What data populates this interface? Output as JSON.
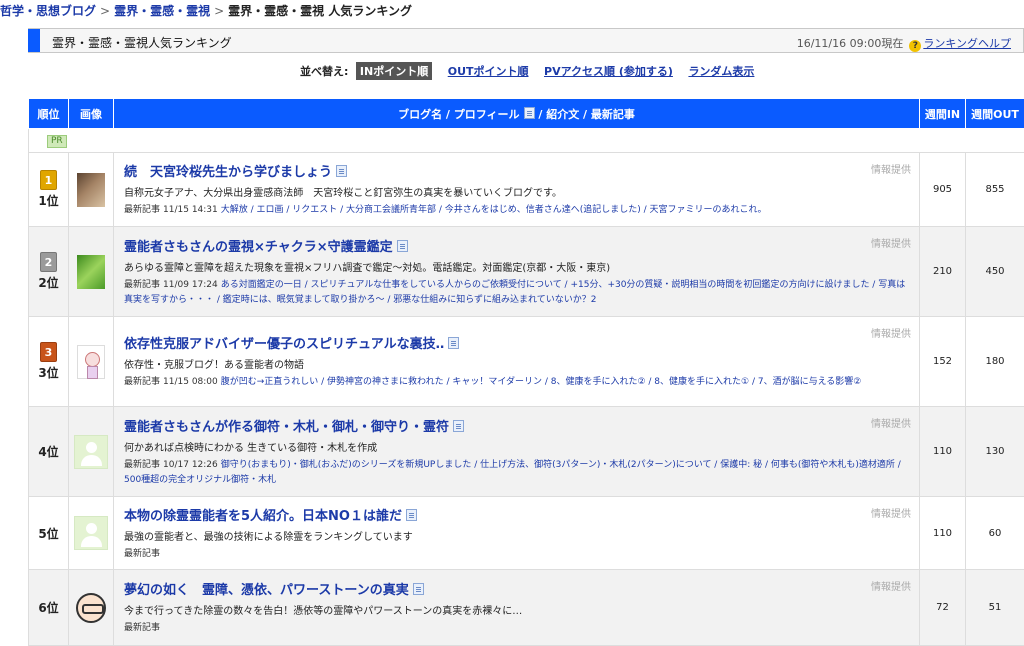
{
  "breadcrumb": {
    "items": [
      "哲学・思想ブログ",
      "霊界・霊感・霊視",
      "霊界・霊感・霊視 人気ランキング"
    ],
    "separator": ">"
  },
  "page_header": {
    "title": "霊界・霊感・霊視人気ランキング",
    "timestamp": "16/11/16 09:00現在",
    "help_label": "ランキングヘルプ"
  },
  "sort_bar": {
    "label": "並べ替え:",
    "active": "INポイント順",
    "options": [
      "OUTポイント順",
      "PVアクセス順 (参加する)",
      "ランダム表示"
    ]
  },
  "table": {
    "headers": {
      "rank": "順位",
      "image": "画像",
      "blog": "ブログ名 / プロフィール",
      "blog_rest": " / 紹介文 / 最新記事",
      "weekly_in": "週間IN",
      "weekly_out": "週間OUT"
    },
    "pr_label": "PR",
    "info_label": "情報提供",
    "latest_label": "最新記事",
    "rows": [
      {
        "rank": "1位",
        "medal": "1",
        "title": "続　天宮玲桜先生から学びましょう",
        "desc": "自称元女子アナ、大分県出身霊感商法師　天宮玲桜こと釘宮弥生の真実を暴いていくブログです。",
        "date": "11/15 14:31",
        "latest": "大解放 / エロ画 / リクエスト / 大分商工会議所青年部 / 今井さんをはじめ、信者さん達へ(追記しました) / 天宮ファミリーのあれこれ。",
        "in": "905",
        "out": "855"
      },
      {
        "rank": "2位",
        "medal": "2",
        "title": "霊能者さもさんの霊視×チャクラ×守護霊鑑定",
        "desc": "あらゆる霊障と霊障を超えた現象を霊視×フリハ調査で鑑定～対処。電話鑑定。対面鑑定(京都・大阪・東京)",
        "date": "11/09 17:24",
        "latest": "ある対面鑑定の一日 / スピリチュアルな仕事をしている人からのご依頼受付について / +15分、+30分の質疑・説明相当の時間を初回鑑定の方向けに設けました / 写真は真実を写すから・・・ / 鑑定時には、眠気覚まして取り掛かろ～ / 邪悪な仕組みに知らずに組み込まれていないか？2",
        "in": "210",
        "out": "450"
      },
      {
        "rank": "3位",
        "medal": "3",
        "title": "依存性克服アドバイザー優子のスピリチュアルな裏技‥",
        "desc": "依存性・克服ブログ！ある霊能者の物語",
        "date": "11/15 08:00",
        "latest": "腹が凹む→正直うれしい / 伊勢神宮の神さまに救われた / キャッ！マイダーリン / 8、健康を手に入れた② / 8、健康を手に入れた① / 7、酒が脳に与える影響②",
        "in": "152",
        "out": "180"
      },
      {
        "rank": "4位",
        "medal": "",
        "title": "霊能者さもさんが作る御符・木札・御札・御守り・霊符",
        "desc": "何かあれば点検時にわかる 生きている御符・木札を作成",
        "date": "10/17 12:26",
        "latest": "御守り(おまもり)・御札(おふだ)のシリーズを新規UPしました / 仕上げ方法、御符(3パターン)・木札(2パターン)について / 保護中: 秘 / 何事も(御符や木札も)適材適所 / 500種超の完全オリジナル御符・木札",
        "in": "110",
        "out": "130"
      },
      {
        "rank": "5位",
        "medal": "",
        "title": "本物の除霊霊能者を5人紹介。日本NO１は誰だ",
        "desc": "最強の霊能者と、最強の技術による除霊をランキングしています",
        "date": "",
        "latest": "",
        "in": "110",
        "out": "60"
      },
      {
        "rank": "6位",
        "medal": "",
        "title": "夢幻の如く　霊障、憑依、パワーストーンの真実",
        "desc": "今まで行ってきた除霊の数々を告白！憑依等の霊障やパワーストーンの真実を赤裸々に…",
        "date": "",
        "latest": "",
        "in": "72",
        "out": "51"
      }
    ]
  }
}
